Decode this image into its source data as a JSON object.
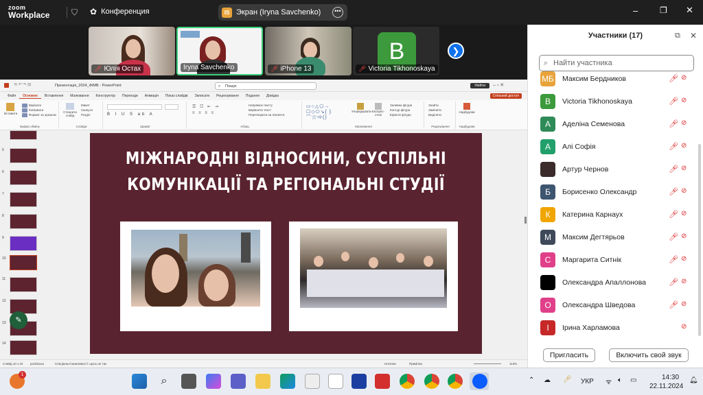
{
  "app": {
    "logo_line1": "zoom",
    "logo_line2": "Workplace",
    "conference_label": "Конференция"
  },
  "screen_share": {
    "badge": "IS",
    "label": "Экран (Iryna Savchenko)",
    "more_icon": "ellipsis-icon"
  },
  "video_tiles": [
    {
      "name": "Юлія Остах",
      "muted": true
    },
    {
      "name": "Iryna Savchenko",
      "muted": false
    },
    {
      "name": "iPhone 13",
      "muted": true
    },
    {
      "name": "Victoria Tikhonoskaya",
      "muted": true,
      "avatar_letter": "B"
    }
  ],
  "powerpoint": {
    "document_title": "Презентація_2024_ФІМВ  -  PowerPoint",
    "search_placeholder": "Пошук",
    "enter_label": "Увійти",
    "share_label": "Спільний доступ",
    "tabs": [
      "Файл",
      "Основне",
      "Вставлення",
      "Малювання",
      "Конструктор",
      "Переходи",
      "Анімація",
      "Показ слайдів",
      "Записати",
      "Рецензування",
      "Подання",
      "Довідка"
    ],
    "active_tab": "Основне",
    "ribbon": {
      "clipboard": {
        "label": "Буфер обміну",
        "paste": "Вставити",
        "cut": "Вирізати",
        "copy": "Копіювати",
        "format": "Формат за зразком"
      },
      "slides": {
        "label": "Слайди",
        "new": "Створити слайд",
        "layout": "Макет",
        "reset": "Скинути",
        "section": "Розділ"
      },
      "font": {
        "label": "Шрифт"
      },
      "paragraph": {
        "label": "Абзац",
        "direction": "Напрямок тексту",
        "align": "Вирівняти текст",
        "smartart": "Перетворити на SmartArt"
      },
      "drawing": {
        "label": "Малювання",
        "arrange": "Упорядкувати",
        "styles": "Експрес-стилі",
        "fill": "Заливка фігури",
        "outline": "Контур фігури",
        "effects": "Ефекти фігури"
      },
      "editing": {
        "label": "Редагування",
        "find": "Знайти",
        "replace": "Замінити",
        "select": "Виділити"
      },
      "addins": {
        "label": "Надбудови",
        "btn": "Надбудови"
      }
    },
    "thumbnail_numbers": [
      "5",
      "6",
      "7",
      "8",
      "9",
      "10",
      "11",
      "12",
      "13",
      "14"
    ],
    "active_slide": "10",
    "status": {
      "slide": "Слайд 10 з 22",
      "lang": "російська",
      "access": "Спеціальні можливості: щось не так",
      "notes": "Нотатки",
      "comments": "Примітки",
      "zoom": "113%"
    }
  },
  "slide": {
    "title_line1": "Міжнародні відносини, суспільні",
    "title_line2": "комунікації та регіональні студії",
    "background_color": "#5a2330"
  },
  "participants": {
    "title": "Участники (17)",
    "search_placeholder": "Найти участника",
    "list": [
      {
        "initials": "МБ",
        "name": "Максим Бердников",
        "color": "#e8a33b",
        "mic_muted": true,
        "video_off": true
      },
      {
        "initials": "B",
        "name": "Victoria Tikhonoskaya",
        "color": "#3c9a3c",
        "mic_muted": true,
        "video_off": true
      },
      {
        "initials": "А",
        "name": "Аделіна Семенова",
        "color": "#2e8b57",
        "mic_muted": true,
        "video_off": true
      },
      {
        "initials": "А",
        "name": "Алі Софія",
        "color": "#22a06b",
        "mic_muted": true,
        "video_off": true
      },
      {
        "initials": "",
        "name": "Артур Чернов",
        "color": "#3b2b2b",
        "mic_muted": true,
        "video_off": true
      },
      {
        "initials": "Б",
        "name": "Борисенко Олександр",
        "color": "#3e5570",
        "mic_muted": true,
        "video_off": true
      },
      {
        "initials": "К",
        "name": "Катерина Карнаух",
        "color": "#f0a500",
        "mic_muted": true,
        "video_off": true
      },
      {
        "initials": "М",
        "name": "Максим Дегтярьов",
        "color": "#3e4a5a",
        "mic_muted": true,
        "video_off": true
      },
      {
        "initials": "С",
        "name": "Маргарита Ситнік",
        "color": "#e0408a",
        "mic_muted": true,
        "video_off": true
      },
      {
        "initials": "",
        "name": "Олександра Апаллонова",
        "color": "#000000",
        "mic_muted": true,
        "video_off": true
      },
      {
        "initials": "О",
        "name": "Олександра Шведова",
        "color": "#e0408a",
        "mic_muted": true,
        "video_off": true
      },
      {
        "initials": "І",
        "name": "Ірина Харламова",
        "color": "#c62828",
        "mic_muted": false,
        "video_off": true
      }
    ],
    "invite_label": "Пригласить",
    "unmute_label": "Включить свой звук"
  },
  "taskbar": {
    "notification_count": "1",
    "lang": "УКР",
    "time": "14:30",
    "date": "22.11.2024"
  }
}
